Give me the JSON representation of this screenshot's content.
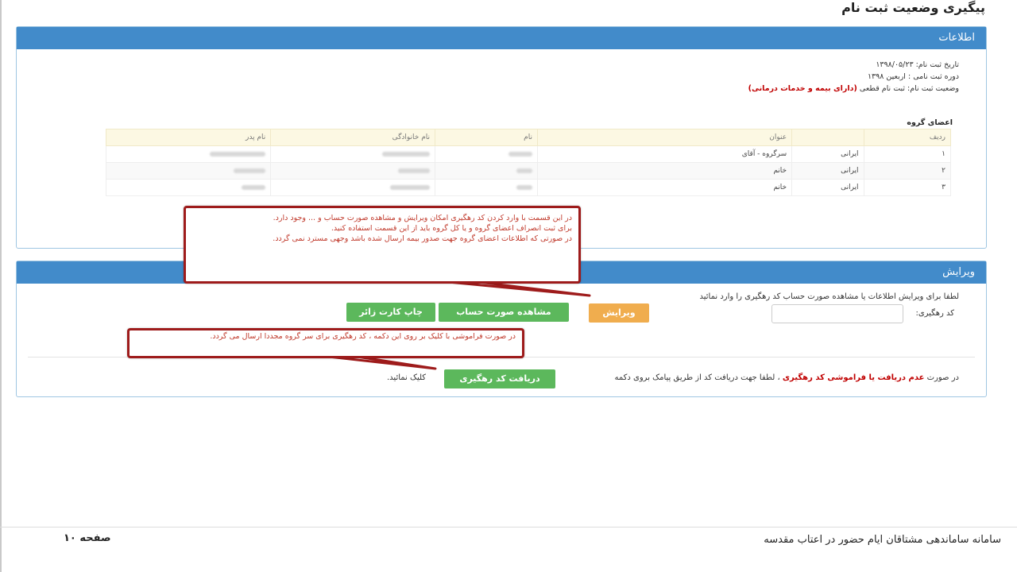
{
  "page": {
    "title": "پیگیری وضعیت ثبت نام"
  },
  "info_panel": {
    "heading": "اطلاعات",
    "registration_date": "تاریخ ثبت نام: ۱۳۹۸/۰۵/۲۳",
    "registration_period": "دوره ثبت نامی : اربعین ۱۳۹۸",
    "status_label": "وضعیت ثبت نام: ثبت نام قطعی",
    "status_value": "(دارای بیمه و خدمات درمانی)",
    "group_title": "اعضای گروه",
    "table": {
      "headers": [
        "ردیف",
        "",
        "عنوان",
        "نام",
        "نام خانوادگی",
        "نام پدر"
      ],
      "rows": [
        [
          "۱",
          "ایرانی",
          "سرگروه - آقای"
        ],
        [
          "۲",
          "ایرانی",
          "خانم"
        ],
        [
          "۳",
          "ایرانی",
          "خانم"
        ]
      ]
    }
  },
  "edit_panel": {
    "heading": "ویرایش",
    "instruction": "لطفا برای ویرایش اطلاعات یا مشاهده صورت حساب کد رهگیری را وارد نمائید",
    "code_label": "کد رهگیری:",
    "code_value": "",
    "edit_button": "ویرایش",
    "view_invoice_button": "مشاهده صورت حساب",
    "print_card_button": "چاپ کارت زائر",
    "notice_prefix": "در صورت",
    "notice_red": "عدم دریافت یا فراموشی کد رهگیری",
    "notice_middle": "، لطفا جهت دریافت کد از طریق پیامک بروی دکمه",
    "notice_suffix": "کلیک نمائید.",
    "get_code_button": "دریافت کد رهگیری"
  },
  "callouts": {
    "first": [
      "در این قسمت با وارد کردن کد رهگیری امکان ویرایش و مشاهده صورت حساب و ... وجود دارد.",
      "برای ثبت انصراف اعضای گروه و یا کل گروه باید از این قسمت استفاده کنید.",
      "در صورتی که اطلاعات اعضای گروه جهت صدور بیمه ارسال شده باشد وجهی مسترد نمی گردد."
    ],
    "second": "در صورت فراموشی با کلیک بر روی این دکمه ، کد رهگیری برای سر گروه مجددا ارسال می گردد."
  },
  "footer": {
    "system_name": "سامانه ساماندهی مشتاقان ایام حضور در اعتاب مقدسه",
    "page_number": "صفحه ۱۰"
  },
  "colors": {
    "panel_header": "#428bca",
    "orange_button": "#f0ad4e",
    "green_button": "#5cb85c",
    "callout_border": "#9e1b1b",
    "alert_text": "#c00000"
  }
}
